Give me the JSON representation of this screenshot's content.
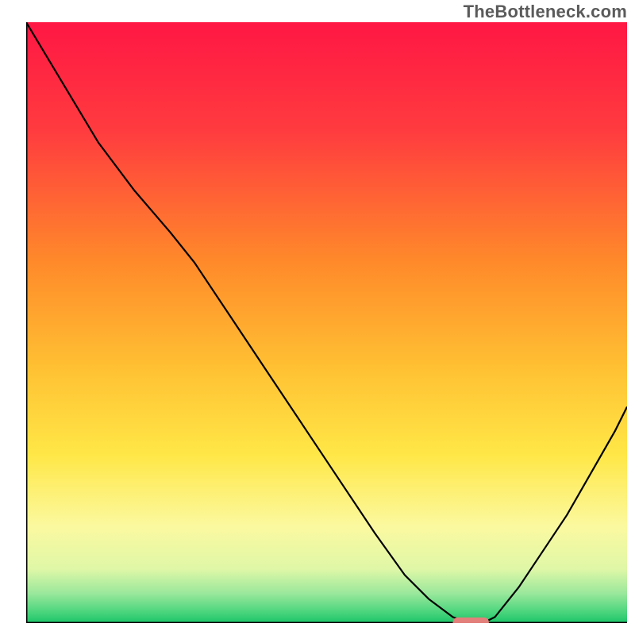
{
  "watermark": "TheBottleneck.com",
  "chart_data": {
    "type": "line",
    "title": "",
    "xlabel": "",
    "ylabel": "",
    "xlim": [
      0,
      100
    ],
    "ylim": [
      0,
      100
    ],
    "grid": false,
    "legend": false,
    "background_gradient_stops": [
      {
        "offset": 0,
        "color": "#ff1744"
      },
      {
        "offset": 18,
        "color": "#ff3b3f"
      },
      {
        "offset": 40,
        "color": "#ff8a2a"
      },
      {
        "offset": 58,
        "color": "#ffc233"
      },
      {
        "offset": 72,
        "color": "#ffe747"
      },
      {
        "offset": 84,
        "color": "#fbf9a0"
      },
      {
        "offset": 91,
        "color": "#dff7a7"
      },
      {
        "offset": 95,
        "color": "#9be89c"
      },
      {
        "offset": 98,
        "color": "#4fd67f"
      },
      {
        "offset": 100,
        "color": "#1bc468"
      }
    ],
    "series": [
      {
        "name": "curve",
        "x": [
          0,
          6,
          12,
          18,
          24,
          28,
          34,
          40,
          46,
          52,
          58,
          63,
          67,
          71,
          74,
          76,
          78,
          82,
          86,
          90,
          94,
          98,
          100
        ],
        "values": [
          100,
          90,
          80,
          72,
          65,
          60,
          51,
          42,
          33,
          24,
          15,
          8,
          4,
          1,
          0,
          0,
          1,
          6,
          12,
          18,
          25,
          32,
          36
        ]
      }
    ],
    "marker": {
      "x_start": 71,
      "x_end": 77,
      "y": 0,
      "color": "#e3807b"
    }
  }
}
